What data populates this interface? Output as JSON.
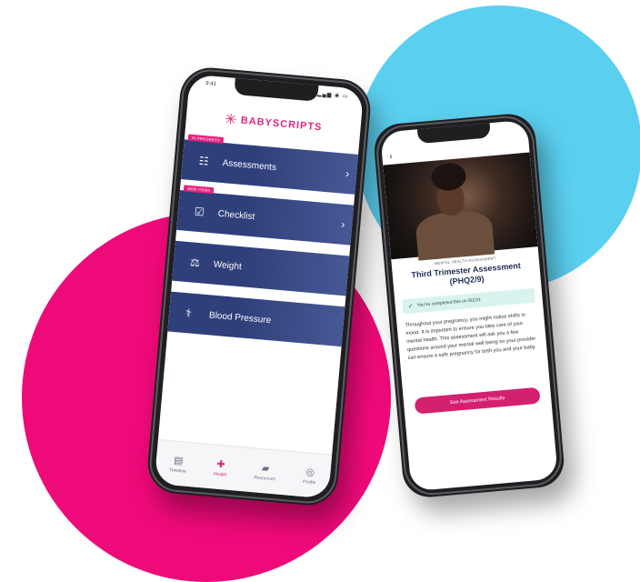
{
  "colors": {
    "brand_pink": "#e4237d",
    "navy": "#2f3f7a",
    "circle_blue": "#5bcfef",
    "circle_pink": "#ef0a79",
    "mint": "#d8f3ee"
  },
  "phone1": {
    "status_time": "9:41",
    "status_icons": "▂▄▆ ◉ ▭",
    "logo": {
      "mark": "✳",
      "text": "BABYSCRIPTS",
      "mark_icon": "logo-burst-icon"
    },
    "menu": [
      {
        "tag": "IN PROGRESS",
        "label": "Assessments",
        "icon": "clipboard-icon",
        "glyph": "☷",
        "chevron": "›"
      },
      {
        "tag": "NEW ITEMS",
        "label": "Checklist",
        "icon": "checkbox-icon",
        "glyph": "☑",
        "chevron": "›"
      },
      {
        "tag": "",
        "label": "Weight",
        "icon": "weight-icon",
        "glyph": "⚖",
        "chevron": ""
      },
      {
        "tag": "",
        "label": "Blood Pressure",
        "icon": "stethoscope-icon",
        "glyph": "⚕",
        "chevron": ""
      }
    ],
    "tabs": [
      {
        "label": "Timeline",
        "icon": "timeline-icon",
        "glyph": "▤",
        "active": false
      },
      {
        "label": "Health",
        "icon": "health-icon",
        "glyph": "✚",
        "active": true
      },
      {
        "label": "Resources",
        "icon": "folder-icon",
        "glyph": "▰",
        "active": false
      },
      {
        "label": "Profile",
        "icon": "profile-icon",
        "glyph": "◎",
        "active": false
      }
    ]
  },
  "phone2": {
    "back": "‹",
    "kicker": "MENTAL HEALTH ASSESSMENT",
    "title": "Third Trimester Assessment (PHQ2/9)",
    "completed_text": "You've completed this on 9/1/21",
    "completed_icon": "check-circle-icon",
    "description": "Throughout your pregnancy, you might notice shifts in mood. It is important to ensure you take care of your mental health. This assessment will ask you a few questions around your mental well being so your provider can ensure a safe pregnancy for both you and your baby.",
    "cta": "See Assessment Results"
  }
}
